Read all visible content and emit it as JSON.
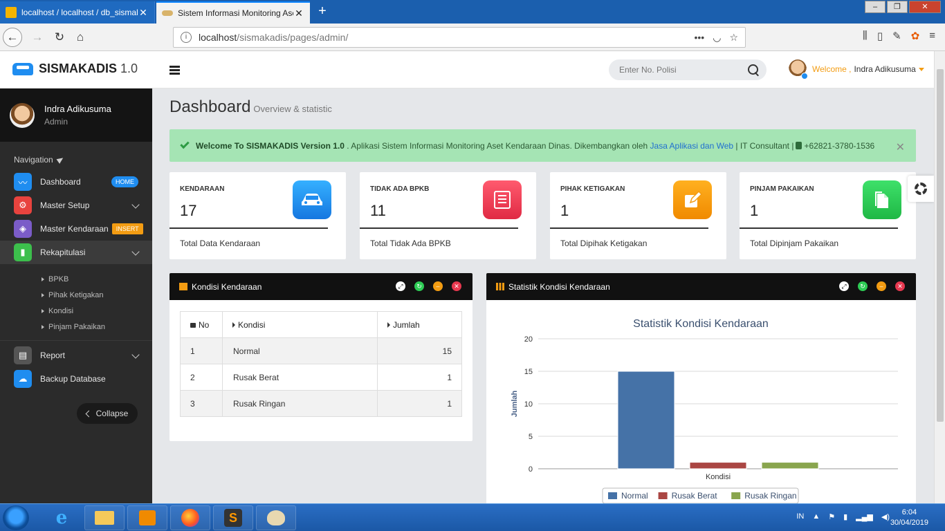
{
  "browser": {
    "tabs": [
      {
        "title": "localhost / localhost / db_sismakadis",
        "active": false
      },
      {
        "title": "Sistem Informasi Monitoring Aset Kendaraan Dinas",
        "active": true
      }
    ],
    "url_host": "localhost",
    "url_path": "/sismakadis/pages/admin/"
  },
  "app": {
    "brand_name": "SISMAKADIS",
    "brand_version": "1.0",
    "search_placeholder": "Enter No. Polisi",
    "welcome_label": "Welcome ,",
    "user_name": "Indra Adikusuma"
  },
  "sidebar": {
    "user_name": "Indra Adikusuma",
    "user_role": "Admin",
    "nav_heading": "Navigation",
    "items": [
      {
        "label": "Dashboard",
        "badge": "HOME",
        "badge_color": "#1f8df0",
        "icon_color": "#1f8df0"
      },
      {
        "label": "Master Setup",
        "icon_color": "#e8433e"
      },
      {
        "label": "Master Kendaraan",
        "badge": "INSERT",
        "badge_color": "#f39c12",
        "icon_color": "#7b5cc8"
      },
      {
        "label": "Rekapitulasi",
        "icon_color": "#3cbf4c"
      }
    ],
    "sub_items": [
      "BPKB",
      "Pihak Ketigakan",
      "Kondisi",
      "Pinjam Pakaikan"
    ],
    "items2": [
      {
        "label": "Report",
        "icon_color": "#555555"
      },
      {
        "label": "Backup Database",
        "icon_color": "#1f8df0"
      }
    ],
    "collapse_label": "Collapse"
  },
  "page": {
    "title": "Dashboard",
    "subtitle": "Overview & statistic"
  },
  "alert": {
    "bold": "Welcome To SISMAKADIS Version 1.0",
    "text": ". Aplikasi Sistem Informasi Monitoring Aset Kendaraan Dinas. Dikembangkan oleh",
    "link": "Jasa Aplikasi dan Web",
    "tail": "| IT Consultant |",
    "phone": "+62821-3780-1536"
  },
  "stats": [
    {
      "label": "KENDARAAN",
      "value": "17",
      "footer": "Total Data Kendaraan",
      "color": "#1f8df0",
      "icon": "car-icon"
    },
    {
      "label": "TIDAK ADA BPKB",
      "value": "11",
      "footer": "Total Tidak Ada BPKB",
      "color": "#e8384f",
      "icon": "document-icon"
    },
    {
      "label": "PIHAK KETIGAKAN",
      "value": "1",
      "footer": "Total Dipihak Ketigakan",
      "color": "#f39c12",
      "icon": "edit-icon"
    },
    {
      "label": "PINJAM PAKAIKAN",
      "value": "1",
      "footer": "Total Dipinjam Pakaikan",
      "color": "#2ecc55",
      "icon": "file-icon"
    }
  ],
  "kondisi_panel": {
    "title": "Kondisi Kendaraan",
    "headers": [
      "No",
      "Kondisi",
      "Jumlah"
    ],
    "rows": [
      [
        "1",
        "Normal",
        "15"
      ],
      [
        "2",
        "Rusak Berat",
        "1"
      ],
      [
        "3",
        "Rusak Ringan",
        "1"
      ]
    ]
  },
  "chart_panel": {
    "title": "Statistik Kondisi Kendaraan"
  },
  "chart_data": {
    "type": "bar",
    "title": "Statistik Kondisi Kendaraan",
    "categories": [
      "Kondisi"
    ],
    "series": [
      {
        "name": "Normal",
        "values": [
          15
        ],
        "color": "#4572a7"
      },
      {
        "name": "Rusak Berat",
        "values": [
          1
        ],
        "color": "#aa4643"
      },
      {
        "name": "Rusak Ringan",
        "values": [
          1
        ],
        "color": "#89a54e"
      }
    ],
    "xlabel": "Kondisi",
    "ylabel": "Jumlah",
    "ylim": [
      0,
      20
    ],
    "yticks": [
      0,
      5,
      10,
      15,
      20
    ],
    "grid": true,
    "legend": "bottom"
  },
  "taskbar": {
    "lang": "IN",
    "time": "6:04",
    "date": "30/04/2019"
  }
}
